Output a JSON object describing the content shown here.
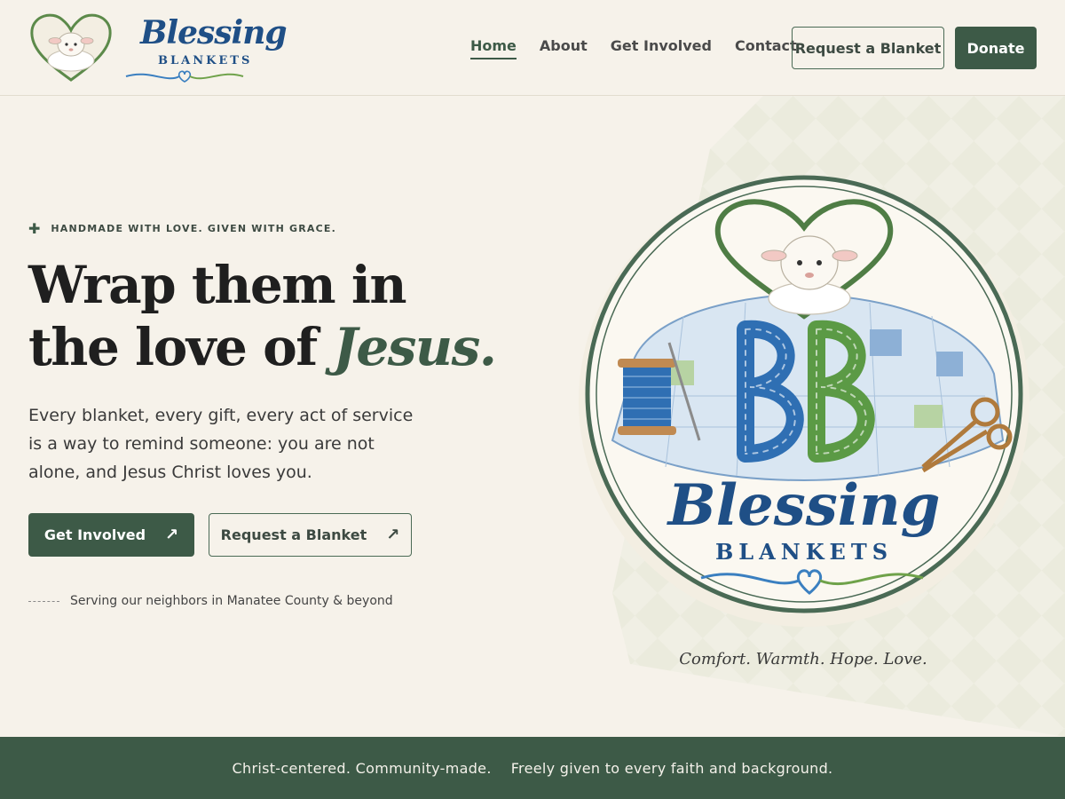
{
  "brand": {
    "name": "Blessing",
    "sub": "BLANKETS"
  },
  "nav": {
    "items": [
      {
        "label": "Home",
        "active": true
      },
      {
        "label": "About"
      },
      {
        "label": "Get Involved"
      },
      {
        "label": "Contact"
      }
    ],
    "request_label": "Request a Blanket",
    "donate_label": "Donate"
  },
  "hero": {
    "eyebrow": "HANDMADE WITH LOVE. GIVEN WITH GRACE.",
    "headline_line1": "Wrap them in",
    "headline_line2": "the love of ",
    "headline_em": "Jesus.",
    "lead": "Every blanket, every gift, every act of service is a way to remind someone: you are not alone, and Jesus Christ loves you.",
    "cta_primary": "Get Involved",
    "cta_secondary": "Request a Blanket",
    "cta_arrow": "↗",
    "serving": "Serving our neighbors in Manatee County & beyond"
  },
  "badge": {
    "word": "Blessing",
    "sub": "BLANKETS",
    "tagline": "Comfort. Warmth. Hope. Love."
  },
  "band": {
    "left": "Christ-centered. Community-made.",
    "right": "Freely given to every faith and background."
  },
  "colors": {
    "bg": "#f6f2ea",
    "green": "#3d5a47",
    "navy": "#1f4f86",
    "blue": "#3a7fc0",
    "leaf": "#6fa24a"
  }
}
